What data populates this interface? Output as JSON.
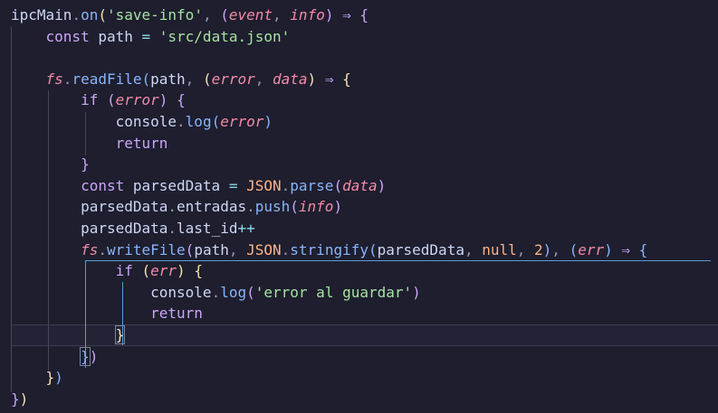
{
  "editor": {
    "lines": [
      [
        [
          "ipcMain",
          "v"
        ],
        [
          ".",
          "pc"
        ],
        [
          "on",
          "f"
        ],
        [
          "(",
          "b1"
        ],
        [
          "'save-info'",
          "s"
        ],
        [
          ", ",
          "pc"
        ],
        [
          "(",
          "b2"
        ],
        [
          "event",
          "p"
        ],
        [
          ", ",
          "pc"
        ],
        [
          "info",
          "p"
        ],
        [
          ")",
          "b2"
        ],
        [
          " ⇒ ",
          "k"
        ],
        [
          "{",
          "b2"
        ]
      ],
      [
        [
          "    ",
          "v"
        ],
        [
          "const ",
          "k"
        ],
        [
          "path",
          "v"
        ],
        [
          " = ",
          "o"
        ],
        [
          "'src/data.json'",
          "s"
        ]
      ],
      [
        [
          "",
          "v"
        ]
      ],
      [
        [
          "    ",
          "v"
        ],
        [
          "fs",
          "p"
        ],
        [
          ".",
          "pc"
        ],
        [
          "readFile",
          "f"
        ],
        [
          "(",
          "b3"
        ],
        [
          "path",
          "v"
        ],
        [
          ", ",
          "pc"
        ],
        [
          "(",
          "b1"
        ],
        [
          "error",
          "p"
        ],
        [
          ", ",
          "pc"
        ],
        [
          "data",
          "p"
        ],
        [
          ")",
          "b1"
        ],
        [
          " ⇒ ",
          "k"
        ],
        [
          "{",
          "b1"
        ]
      ],
      [
        [
          "        ",
          "v"
        ],
        [
          "if ",
          "k"
        ],
        [
          "(",
          "b2"
        ],
        [
          "error",
          "p"
        ],
        [
          ")",
          "b2"
        ],
        [
          " ",
          "v"
        ],
        [
          "{",
          "b2"
        ]
      ],
      [
        [
          "            ",
          "v"
        ],
        [
          "console",
          "v"
        ],
        [
          ".",
          "pc"
        ],
        [
          "log",
          "f"
        ],
        [
          "(",
          "b3"
        ],
        [
          "error",
          "p"
        ],
        [
          ")",
          "b3"
        ]
      ],
      [
        [
          "            ",
          "v"
        ],
        [
          "return",
          "k"
        ]
      ],
      [
        [
          "        ",
          "v"
        ],
        [
          "}",
          "b2"
        ]
      ],
      [
        [
          "        ",
          "v"
        ],
        [
          "const ",
          "k"
        ],
        [
          "parsedData",
          "v"
        ],
        [
          " = ",
          "o"
        ],
        [
          "JSON",
          "n"
        ],
        [
          ".",
          "pc"
        ],
        [
          "parse",
          "f"
        ],
        [
          "(",
          "b2"
        ],
        [
          "data",
          "p"
        ],
        [
          ")",
          "b2"
        ]
      ],
      [
        [
          "        ",
          "v"
        ],
        [
          "parsedData",
          "v"
        ],
        [
          ".",
          "pc"
        ],
        [
          "entradas",
          "v"
        ],
        [
          ".",
          "pc"
        ],
        [
          "push",
          "f"
        ],
        [
          "(",
          "b2"
        ],
        [
          "info",
          "p"
        ],
        [
          ")",
          "b2"
        ]
      ],
      [
        [
          "        ",
          "v"
        ],
        [
          "parsedData",
          "v"
        ],
        [
          ".",
          "pc"
        ],
        [
          "last_id",
          "v"
        ],
        [
          "++",
          "o"
        ]
      ],
      [
        [
          "        ",
          "v"
        ],
        [
          "fs",
          "p"
        ],
        [
          ".",
          "pc"
        ],
        [
          "writeFile",
          "f"
        ],
        [
          "(",
          "b2"
        ],
        [
          "path",
          "v"
        ],
        [
          ", ",
          "pc"
        ],
        [
          "JSON",
          "n"
        ],
        [
          ".",
          "pc"
        ],
        [
          "stringify",
          "f"
        ],
        [
          "(",
          "b3"
        ],
        [
          "parsedData",
          "v"
        ],
        [
          ", ",
          "pc"
        ],
        [
          "null",
          "n"
        ],
        [
          ", ",
          "pc"
        ],
        [
          "2",
          "n"
        ],
        [
          ")",
          "b3"
        ],
        [
          ", ",
          "pc"
        ],
        [
          "(",
          "b3"
        ],
        [
          "err",
          "p"
        ],
        [
          ")",
          "b3"
        ],
        [
          " ⇒ ",
          "k"
        ],
        [
          "{",
          "b3"
        ]
      ],
      [
        [
          "            ",
          "v"
        ],
        [
          "if ",
          "k"
        ],
        [
          "(",
          "b1"
        ],
        [
          "err",
          "p"
        ],
        [
          ")",
          "b1"
        ],
        [
          " ",
          "v"
        ],
        [
          "{",
          "b1"
        ]
      ],
      [
        [
          "                ",
          "v"
        ],
        [
          "console",
          "v"
        ],
        [
          ".",
          "pc"
        ],
        [
          "log",
          "f"
        ],
        [
          "(",
          "b2"
        ],
        [
          "'error al guardar'",
          "s"
        ],
        [
          ")",
          "b2"
        ]
      ],
      [
        [
          "                ",
          "v"
        ],
        [
          "return",
          "k"
        ]
      ],
      [
        [
          "            ",
          "v"
        ],
        [
          "}",
          "bm"
        ]
      ],
      [
        [
          "        ",
          "v"
        ],
        [
          "}",
          "bm3"
        ],
        [
          ")",
          "b2"
        ]
      ],
      [
        [
          "    ",
          "v"
        ],
        [
          "}",
          "b1"
        ],
        [
          ")",
          "b3"
        ]
      ],
      [
        [
          "}",
          "b2"
        ],
        [
          ")",
          "b1"
        ]
      ]
    ]
  }
}
